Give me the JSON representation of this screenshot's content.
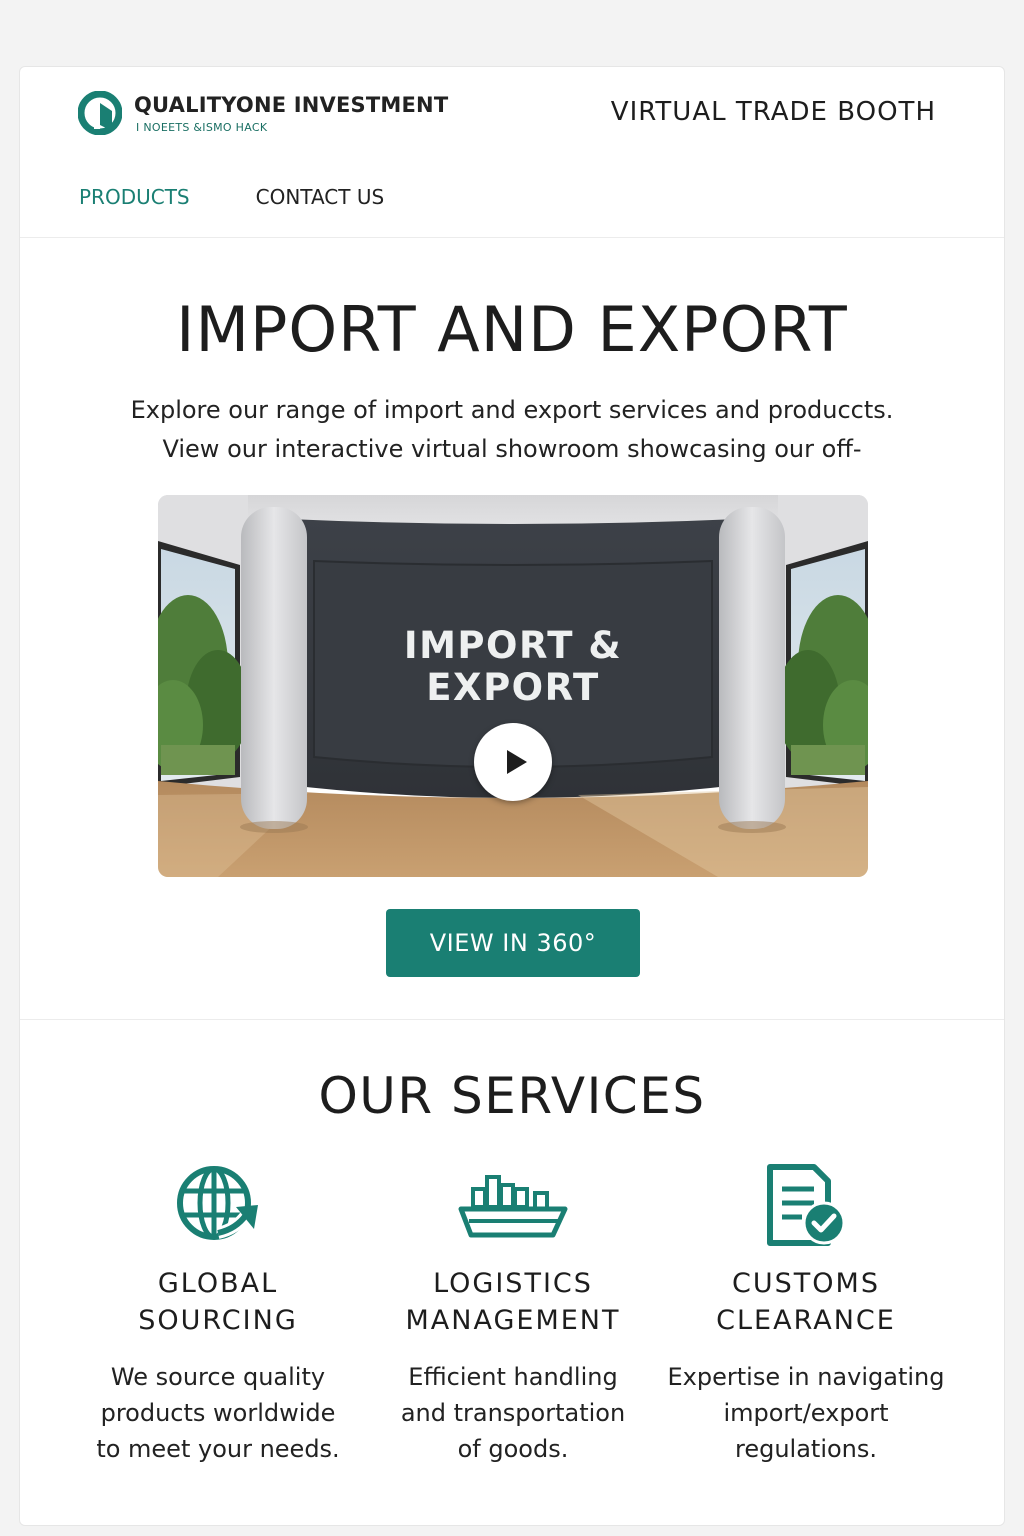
{
  "header": {
    "brand_name": "QUALITYONE INVESTMENT",
    "brand_tagline": "I NOEETS &ISMO HACK",
    "booth_title": "VIRTUAL TRADE BOOTH"
  },
  "nav": {
    "items": [
      {
        "label": "PRODUCTS",
        "active": true
      },
      {
        "label": "CONTACT US",
        "active": false
      }
    ]
  },
  "hero": {
    "title": "IMPORT AND EXPORT",
    "description_line1": "Explore our range of import and export services and produccts.",
    "description_line2": "View our interactive virtual showroom showcasing our off-",
    "showroom_line1": "IMPORT &",
    "showroom_line2": "EXPORT",
    "play_icon": "play-icon",
    "cta_label": "VIEW IN 360°"
  },
  "services": {
    "title": "OUR SERVICES",
    "items": [
      {
        "icon": "globe-arrow-icon",
        "title_line1": "GLOBAL",
        "title_line2": "SOURCING",
        "desc": [
          "We source quality",
          "products worldwide",
          "to meet your needs."
        ]
      },
      {
        "icon": "cargo-ship-icon",
        "title_line1": "LOGISTICS",
        "title_line2": "MANAGEMENT",
        "desc": [
          "Efficient handling",
          "and transportation",
          "of goods."
        ]
      },
      {
        "icon": "document-check-icon",
        "title_line1": "CUSTOMS",
        "title_line2": "CLEARANCE",
        "desc": [
          "Expertise in navigating",
          "import/export",
          "regulations."
        ]
      }
    ]
  },
  "colors": {
    "accent": "#1a7f73",
    "background": "#f3f3f3",
    "card": "#ffffff",
    "text": "#1d1d1d"
  }
}
